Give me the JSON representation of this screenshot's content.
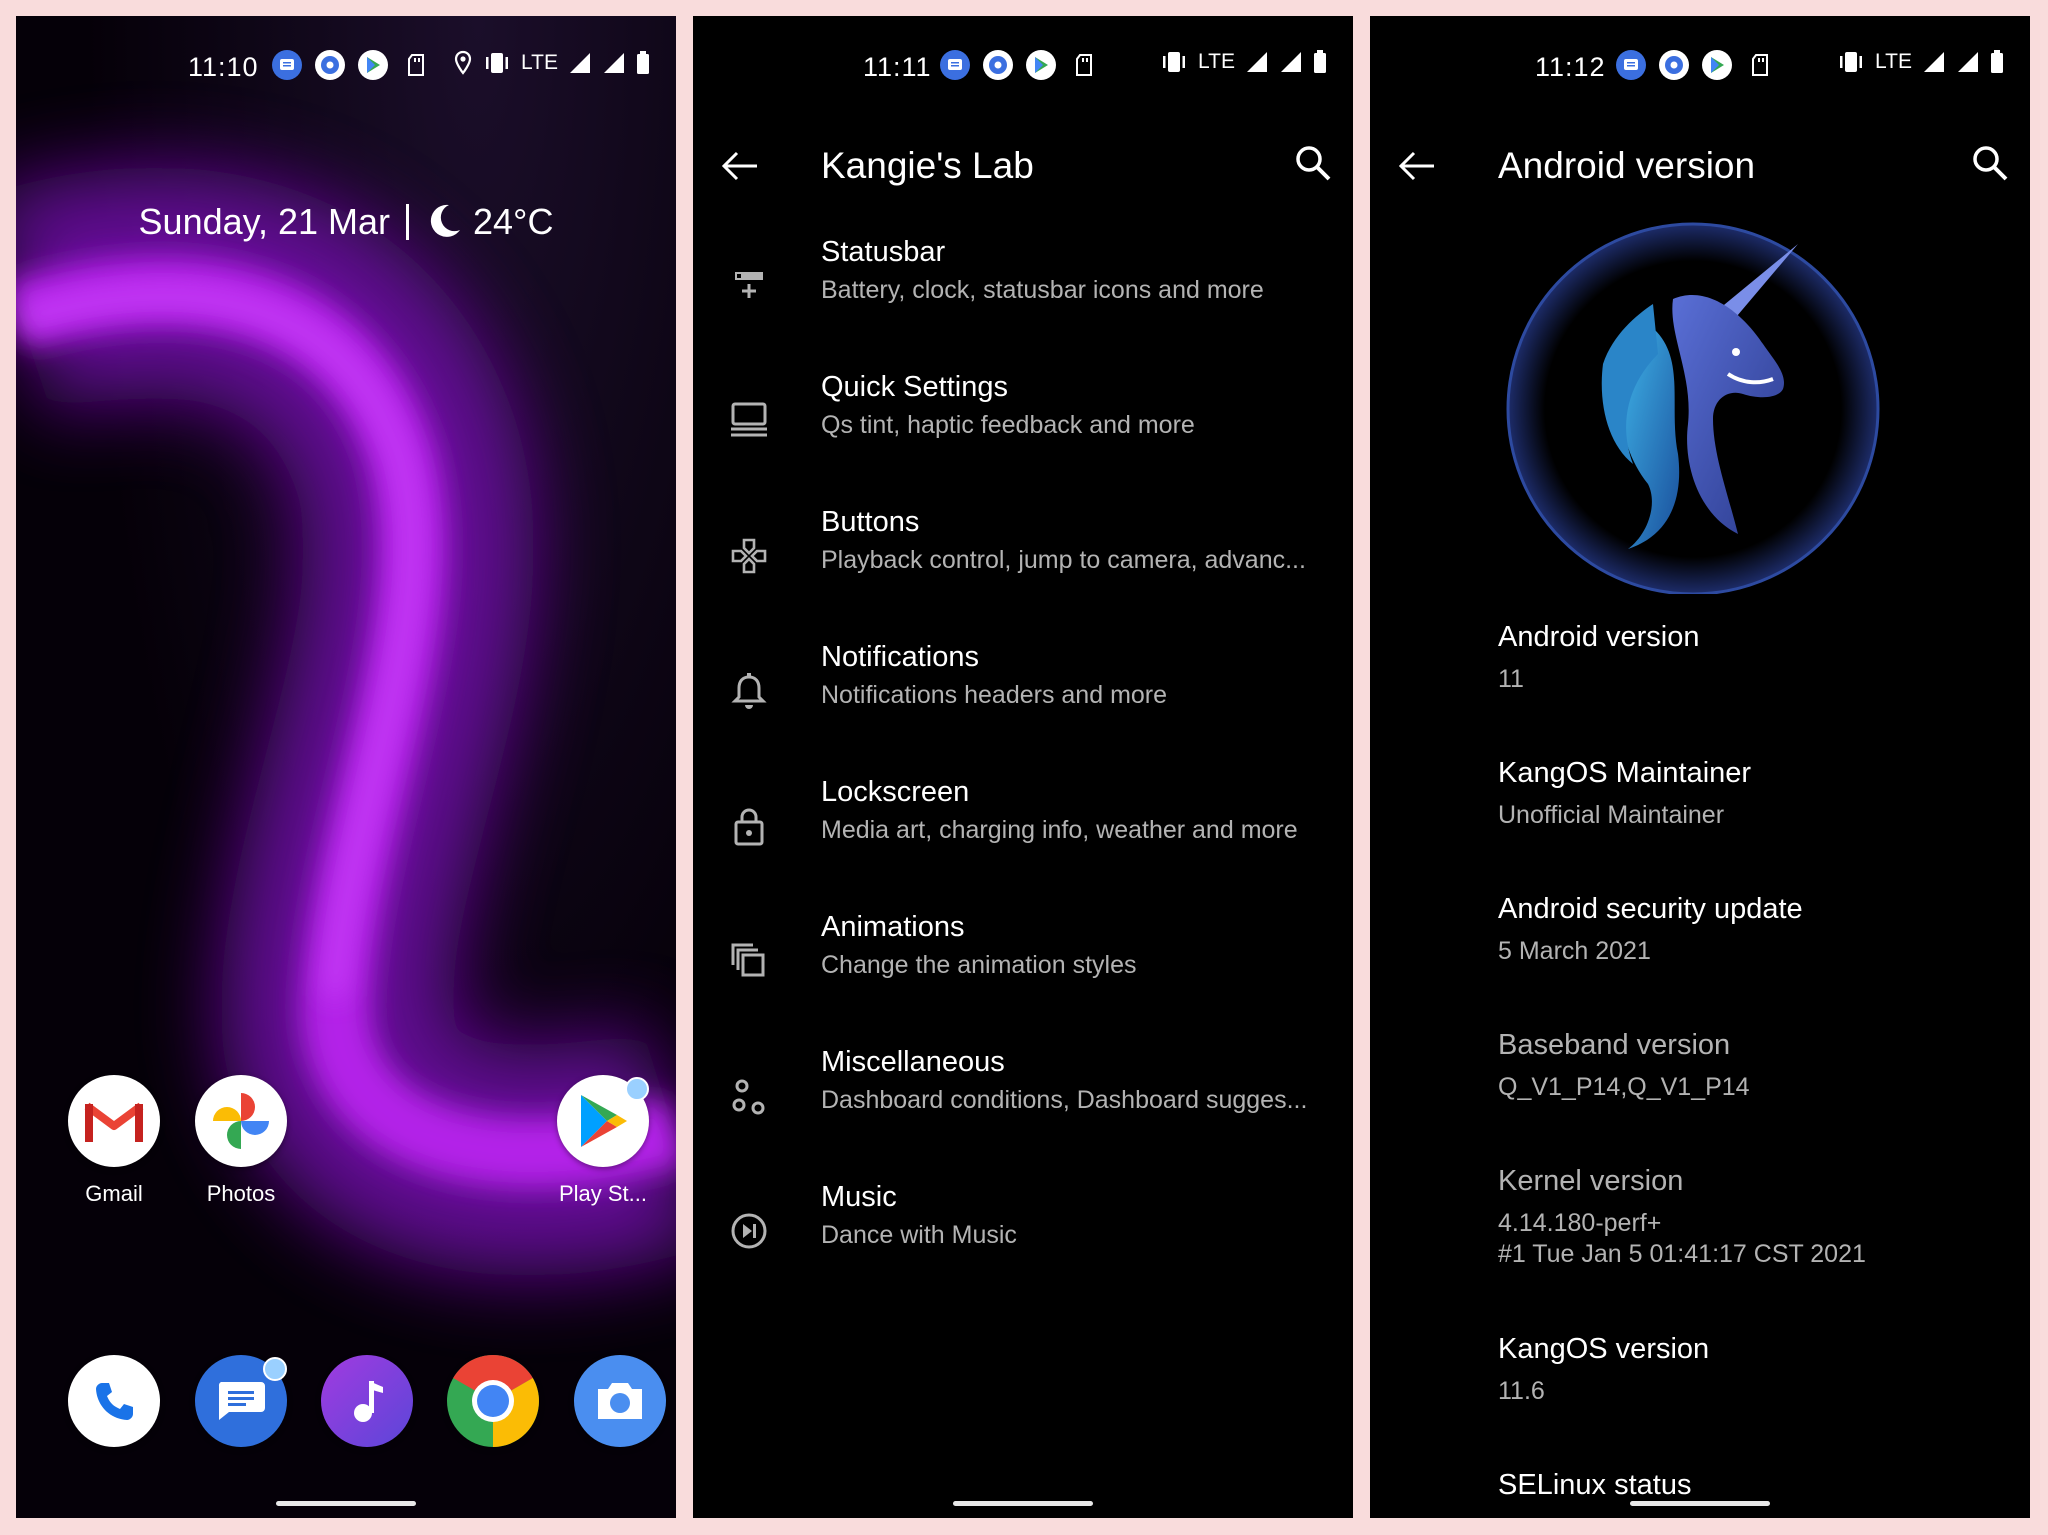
{
  "screen1": {
    "status": {
      "time": "11:10",
      "network": "LTE"
    },
    "date_widget": {
      "date": "Sunday, 21 Mar",
      "temperature": "24°C"
    },
    "apps": [
      {
        "label": "Gmail",
        "icon": "gmail-icon"
      },
      {
        "label": "Photos",
        "icon": "photos-icon"
      },
      {
        "label": "Play St...",
        "icon": "play-store-icon"
      }
    ],
    "dock": [
      "phone-icon",
      "messages-icon",
      "music-icon",
      "chrome-icon",
      "camera-icon"
    ],
    "colors": {
      "accent": "#a020d0"
    }
  },
  "screen2": {
    "status": {
      "time": "11:11",
      "network": "LTE"
    },
    "title": "Kangie's Lab",
    "items": [
      {
        "title": "Statusbar",
        "subtitle": "Battery, clock, statusbar icons and more",
        "icon": "statusbar-icon"
      },
      {
        "title": "Quick Settings",
        "subtitle": "Qs tint, haptic feedback and more",
        "icon": "quick-settings-icon"
      },
      {
        "title": "Buttons",
        "subtitle": "Playback control, jump to camera, advanc...",
        "icon": "buttons-icon"
      },
      {
        "title": "Notifications",
        "subtitle": "Notifications headers and more",
        "icon": "bell-icon"
      },
      {
        "title": "Lockscreen",
        "subtitle": "Media art, charging info, weather and more",
        "icon": "lock-icon"
      },
      {
        "title": "Animations",
        "subtitle": "Change the animation styles",
        "icon": "animations-icon"
      },
      {
        "title": "Miscellaneous",
        "subtitle": "Dashboard conditions, Dashboard sugges...",
        "icon": "misc-icon"
      },
      {
        "title": "Music",
        "subtitle": "Dance with Music",
        "icon": "music-icon"
      }
    ]
  },
  "screen3": {
    "status": {
      "time": "11:12",
      "network": "LTE"
    },
    "title": "Android version",
    "items": [
      {
        "key": "Android version",
        "value": "11"
      },
      {
        "key": "KangOS Maintainer",
        "value": "Unofficial Maintainer"
      },
      {
        "key": "Android security update",
        "value": "5 March 2021"
      },
      {
        "key": "Baseband version",
        "value": "Q_V1_P14,Q_V1_P14"
      },
      {
        "key": "Kernel version",
        "value": "4.14.180-perf+\n#1 Tue Jan 5 01:41:17 CST 2021"
      },
      {
        "key": "KangOS version",
        "value": "11.6"
      },
      {
        "key": "SELinux status",
        "value": ""
      }
    ]
  }
}
